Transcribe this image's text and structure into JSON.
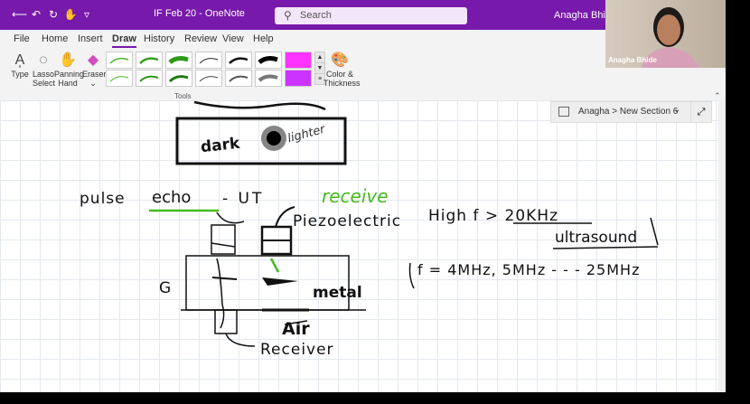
{
  "titlebar": {
    "doc_title": "IF Feb 20  -  OneNote",
    "search_placeholder": "Search",
    "user_name": "Anagha Bhide"
  },
  "menu": [
    "File",
    "Home",
    "Insert",
    "Draw",
    "History",
    "Review",
    "View",
    "Help"
  ],
  "ribbon": {
    "type_label": "Type",
    "lasso_label": "Lasso Select",
    "panning_label": "Panning Hand",
    "eraser_label": "Eraser",
    "color_label": "Color & Thickness",
    "group_label": "Tools"
  },
  "breadcrumb": {
    "text": "Anagha > New Section 6"
  },
  "video": {
    "name": "Anagha Bhide"
  },
  "notes": {
    "box_text_left": "dark",
    "box_text_right": "lighter",
    "pulse": "pulse",
    "echo": "echo",
    "ut": "- UT",
    "receive": "receive",
    "piezo": "Piezoelectric",
    "high_freq": "High f > 20KHz",
    "ultrasound": "ultrasound",
    "freq_list": "f = 4MHz, 5MHz - - - 25MHz",
    "metal": "metal",
    "air": "Air",
    "receiver": "Receiver",
    "left_mark": "G"
  },
  "colors": {
    "accent": "#7719aa",
    "green_ink": "#44bb1e",
    "black_ink": "#111111"
  }
}
